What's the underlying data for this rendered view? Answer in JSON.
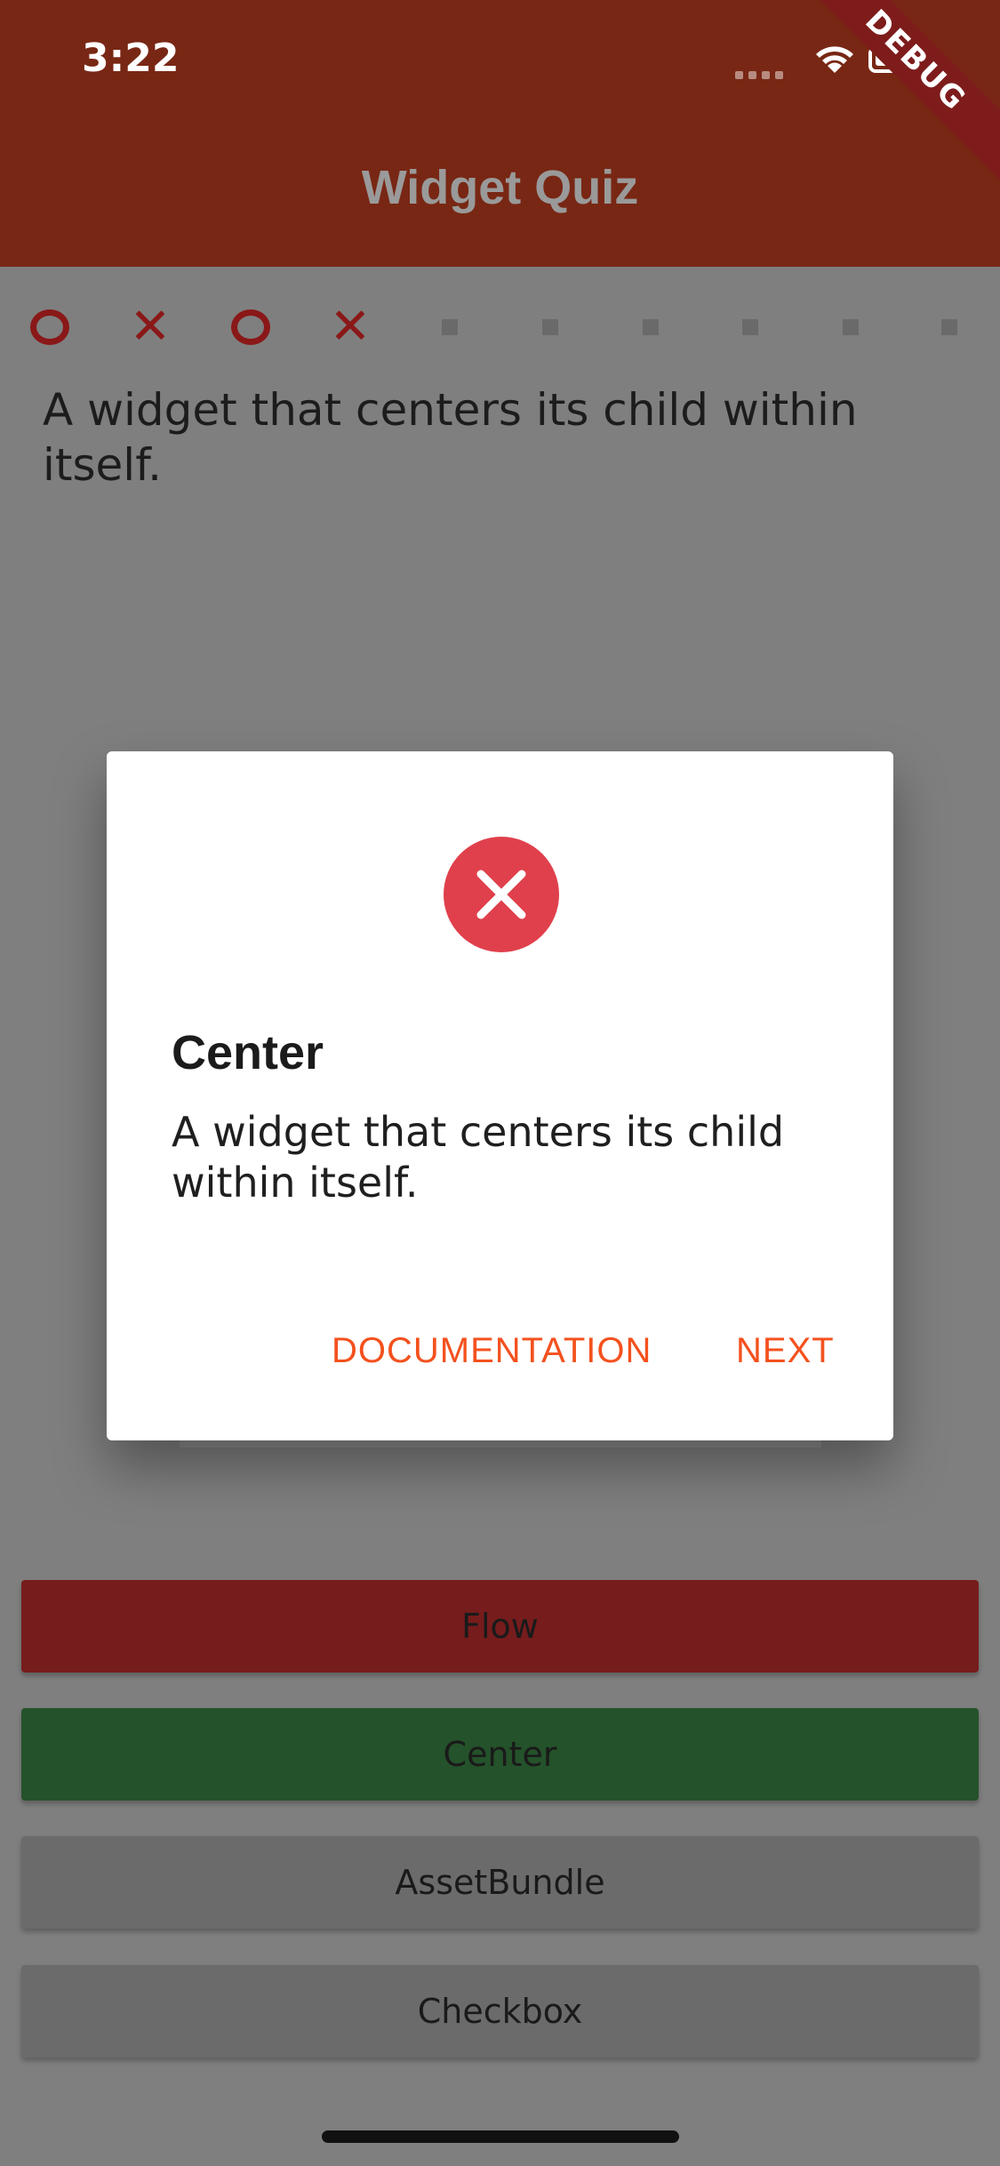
{
  "status_bar": {
    "time": "3:22"
  },
  "debug_banner": "DEBUG",
  "app_bar": {
    "title": "Widget Quiz"
  },
  "score_marks": [
    "o",
    "x",
    "o",
    "x",
    "pending",
    "pending",
    "pending",
    "pending",
    "pending",
    "pending"
  ],
  "question": "A widget that centers its child within itself.",
  "answers": [
    {
      "label": "Flow",
      "state": "wrong"
    },
    {
      "label": "Center",
      "state": "correct"
    },
    {
      "label": "AssetBundle",
      "state": "neutral"
    },
    {
      "label": "Checkbox",
      "state": "neutral"
    }
  ],
  "dialog": {
    "icon": "error-circle-icon",
    "title": "Center",
    "body": "A widget that centers its child within itself.",
    "documentation_label": "DOCUMENTATION",
    "next_label": "NEXT"
  },
  "colors": {
    "app_bar": "#782714",
    "accent": "#f4511e",
    "error": "#e0404c",
    "wrong_answer": "#771c1c",
    "correct_answer": "#24522a"
  }
}
